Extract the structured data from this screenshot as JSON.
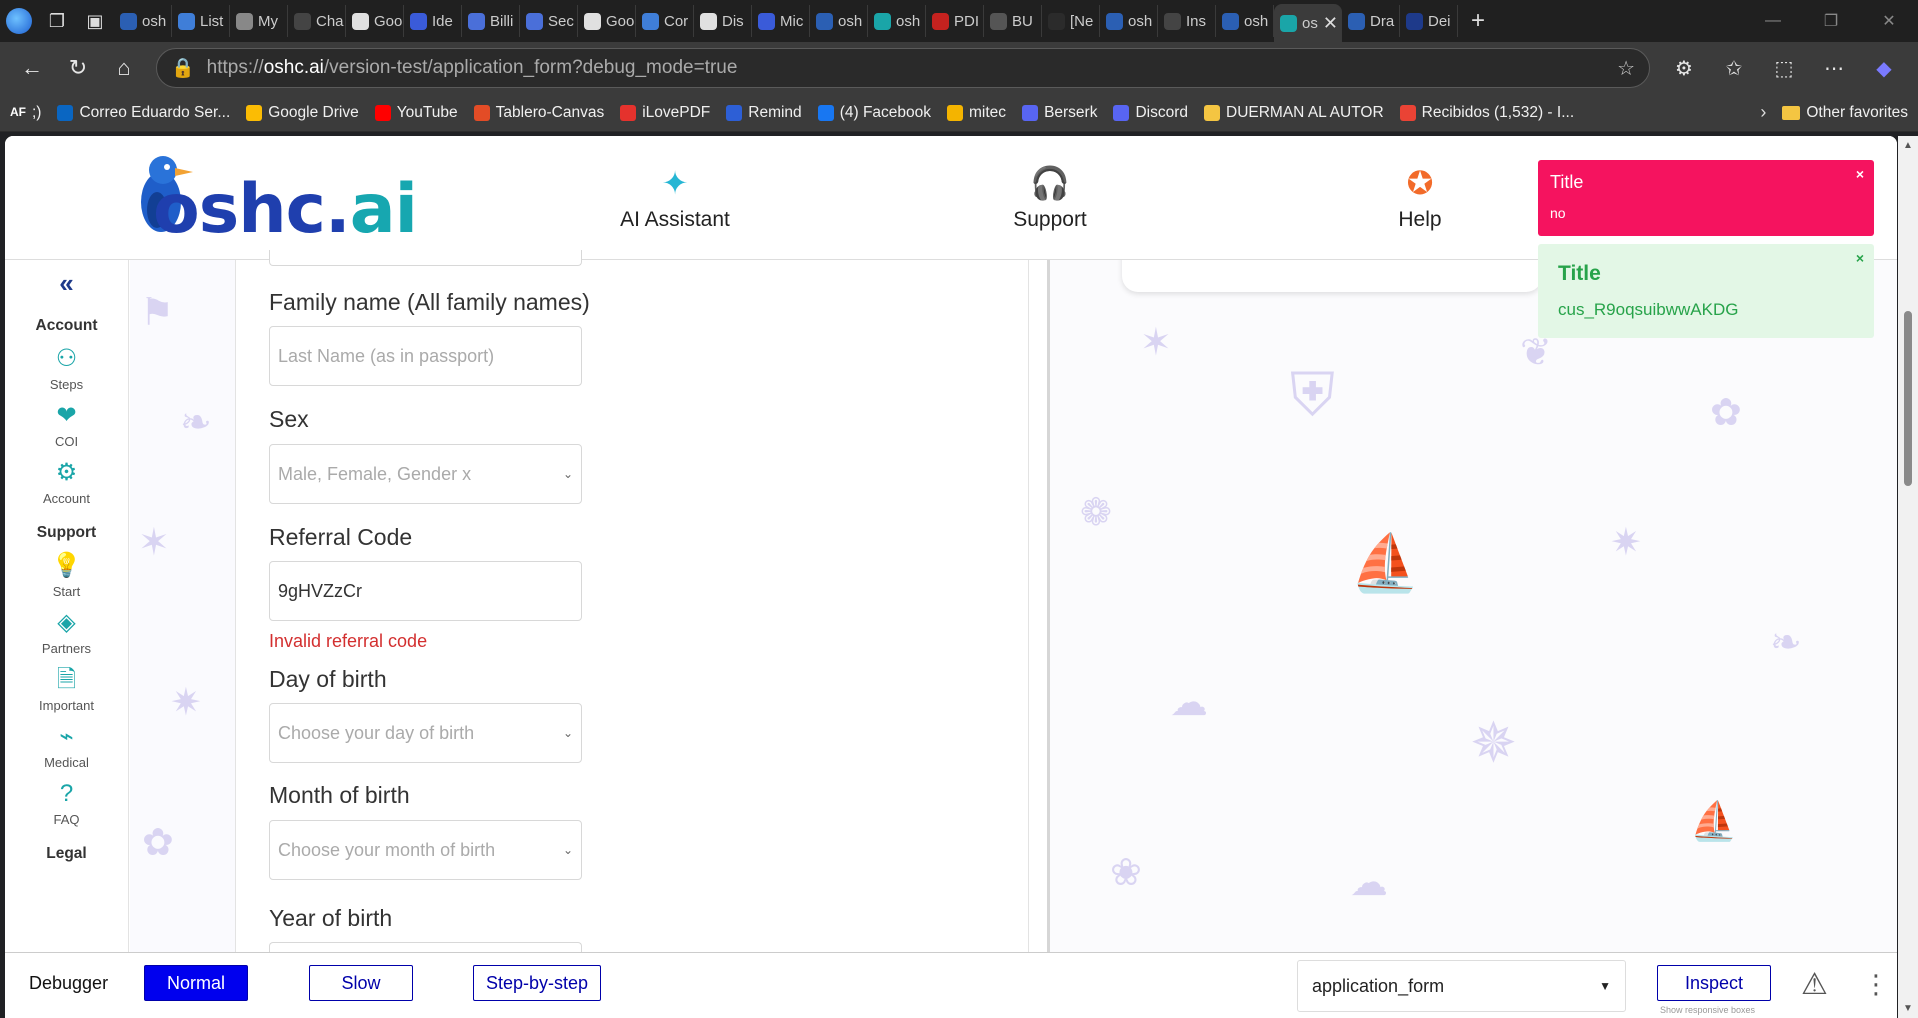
{
  "browser": {
    "tabs": [
      {
        "label": "osh",
        "color": "#2b5fb3"
      },
      {
        "label": "List",
        "color": "#3f7ed8"
      },
      {
        "label": "My",
        "color": "#888888"
      },
      {
        "label": "Cha",
        "color": "#444444"
      },
      {
        "label": "Goo",
        "color": "#e0e0e0"
      },
      {
        "label": "Ide",
        "color": "#3a5bd9"
      },
      {
        "label": "Billi",
        "color": "#4a6fd9"
      },
      {
        "label": "Sec",
        "color": "#4a6fd9"
      },
      {
        "label": "Goo",
        "color": "#e0e0e0"
      },
      {
        "label": "Cor",
        "color": "#3f7ed8"
      },
      {
        "label": "Dis",
        "color": "#e0e0e0"
      },
      {
        "label": "Mic",
        "color": "#3a5bd9"
      },
      {
        "label": "osh",
        "color": "#2b5fb3"
      },
      {
        "label": "osh",
        "color": "#1aa5a8"
      },
      {
        "label": "PDI",
        "color": "#c5221f"
      },
      {
        "label": "BU",
        "color": "#555555"
      },
      {
        "label": "[Ne",
        "color": "#2b2b2b"
      },
      {
        "label": "osh",
        "color": "#2b5fb3"
      },
      {
        "label": "Ins",
        "color": "#444444"
      },
      {
        "label": "osh",
        "color": "#2b5fb3"
      }
    ],
    "active_tab": {
      "label": "os",
      "close": "✕"
    },
    "after_tabs": [
      {
        "label": "Dra",
        "color": "#2b5fb3"
      },
      {
        "label": "Dei",
        "color": "#1e3a8a"
      }
    ],
    "new_tab": "+",
    "url_prefix": "https://",
    "url_host": "oshc.ai",
    "url_path": "/version-test/application_form?debug_mode=true",
    "bookmarks": [
      {
        "label": ";)",
        "icon_text": "AF",
        "color": "#222222"
      },
      {
        "label": "Correo  Eduardo Ser...",
        "color": "#0a66c2"
      },
      {
        "label": "Google Drive",
        "color": "#fbbc04"
      },
      {
        "label": "YouTube",
        "color": "#ff0000"
      },
      {
        "label": "Tablero-Canvas",
        "color": "#e34c26"
      },
      {
        "label": "iLovePDF",
        "color": "#e5322d"
      },
      {
        "label": "Remind",
        "color": "#2d5fd6"
      },
      {
        "label": "(4) Facebook",
        "color": "#1877f2"
      },
      {
        "label": "mitec",
        "color": "#f4b400"
      },
      {
        "label": "Berserk",
        "color": "#5865f2"
      },
      {
        "label": "Discord",
        "color": "#5865f2"
      },
      {
        "label": "DUERMAN AL AUTOR",
        "color": "#f4c542"
      },
      {
        "label": "Recibidos (1,532) - I...",
        "color": "#ea4335"
      }
    ],
    "bookmarks_more": "›",
    "other_favorites": "Other favorites"
  },
  "header": {
    "logo_text": "oshc.ai",
    "nav": [
      {
        "label": "AI Assistant",
        "icon": "sparkle-icon",
        "glyph": "✦",
        "color": "#26b6d4"
      },
      {
        "label": "Support",
        "icon": "headset-icon",
        "glyph": "🎧",
        "color": "#b58be0"
      },
      {
        "label": "Help",
        "icon": "lifebuoy-icon",
        "glyph": "✪",
        "color": "#f26b2a"
      }
    ]
  },
  "sidebar": {
    "collapse": "«",
    "sections": [
      {
        "title": "Account",
        "items": [
          {
            "label": "Steps",
            "icon": "steps-icon",
            "glyph": "⚇"
          },
          {
            "label": "COI",
            "icon": "heart-circle-icon",
            "glyph": "❤"
          },
          {
            "label": "Account",
            "icon": "gear-icon",
            "glyph": "⚙"
          }
        ]
      },
      {
        "title": "Support",
        "items": [
          {
            "label": "Start",
            "icon": "lightbulb-icon",
            "glyph": "💡"
          },
          {
            "label": "Partners",
            "icon": "handshake-icon",
            "glyph": "◈"
          },
          {
            "label": "Important",
            "icon": "document-icon",
            "glyph": "🗎"
          },
          {
            "label": "Medical",
            "icon": "pulse-icon",
            "glyph": "⌁"
          },
          {
            "label": "FAQ",
            "icon": "question-icon",
            "glyph": "?"
          }
        ]
      },
      {
        "title": "Legal",
        "items": []
      }
    ]
  },
  "form": {
    "family_name": {
      "label": "Family name (All family names)",
      "placeholder": "Last Name (as in passport)",
      "value": ""
    },
    "sex": {
      "label": "Sex",
      "placeholder": "Male, Female, Gender x"
    },
    "referral": {
      "label": "Referral Code",
      "value": "9gHVZzCr",
      "error": "Invalid referral code"
    },
    "day_of_birth": {
      "label": "Day of birth",
      "placeholder": "Choose your day of birth"
    },
    "month_of_birth": {
      "label": "Month of birth",
      "placeholder": "Choose your month of birth"
    },
    "year_of_birth": {
      "label": "Year of birth"
    }
  },
  "toasts": {
    "error": {
      "title": "Title",
      "message": "no",
      "close": "×",
      "color": "#f5135f"
    },
    "success": {
      "title": "Title",
      "message": "cus_R9oqsuibwwAKDG",
      "close": "×",
      "color": "#27a34a"
    }
  },
  "debugger": {
    "label": "Debugger",
    "modes": [
      "Normal",
      "Slow",
      "Step-by-step"
    ],
    "active_mode": "Normal",
    "page_select": "application_form",
    "inspect": "Inspect",
    "hint": "Show responsive boxes"
  }
}
